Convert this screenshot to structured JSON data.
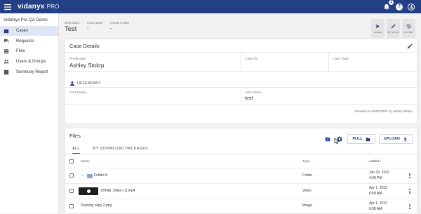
{
  "appbar": {
    "brand": "vidanyx",
    "brand_suffix": "PRO",
    "notifications": "1",
    "help": "?"
  },
  "sidebar": {
    "org": "VidaNyx Pro QA Demo",
    "items": [
      {
        "label": "Cases"
      },
      {
        "label": "Requests"
      },
      {
        "label": "Files"
      },
      {
        "label": "Users & Groups"
      },
      {
        "label": "Summary Report"
      }
    ]
  },
  "header": {
    "defendant_label": "Defendant",
    "defendant_value": "Test",
    "court_label": "Court Date",
    "court_value": "-",
    "incident_label": "Incident Date",
    "incident_value": "-",
    "actions": [
      {
        "label": "SHARE"
      },
      {
        "label": "MY NOTES"
      },
      {
        "label": "HISTORY"
      }
    ]
  },
  "case": {
    "title": "Case Details",
    "prosecutor_label": "Prosecutor",
    "prosecutor_value": "Ashley Stokrp",
    "caseid_label": "Case ID",
    "casetype_label": "Case Type",
    "defendant_section": "DEFENDANT",
    "first_label": "First Name",
    "last_label": "Last Name",
    "last_value": "test",
    "created": "Created on 04/01/2022 by Ashley Stokrp"
  },
  "files": {
    "title": "Files",
    "pull": "PULL",
    "upload": "UPLOAD",
    "tabs": [
      "ALL",
      "MY DOWNLOAD PACKAGES"
    ],
    "columns": {
      "name": "Name",
      "type": "Type",
      "added": "Added"
    },
    "rows": [
      {
        "name": "Folder A",
        "type": "Folder",
        "date": "Jun 29, 2022",
        "time": "4:09 PM"
      },
      {
        "name": "SHINE_Video (1).mp4",
        "type": "Video",
        "date": "Apr 1, 2022",
        "time": "6:58 AM"
      },
      {
        "name": "Drawing copy 2.png",
        "type": "Image",
        "date": "Apr 1, 2022",
        "time": "6:58 AM"
      }
    ]
  },
  "colors": {
    "primary": "#233f85",
    "background": "#f0f0f0"
  }
}
